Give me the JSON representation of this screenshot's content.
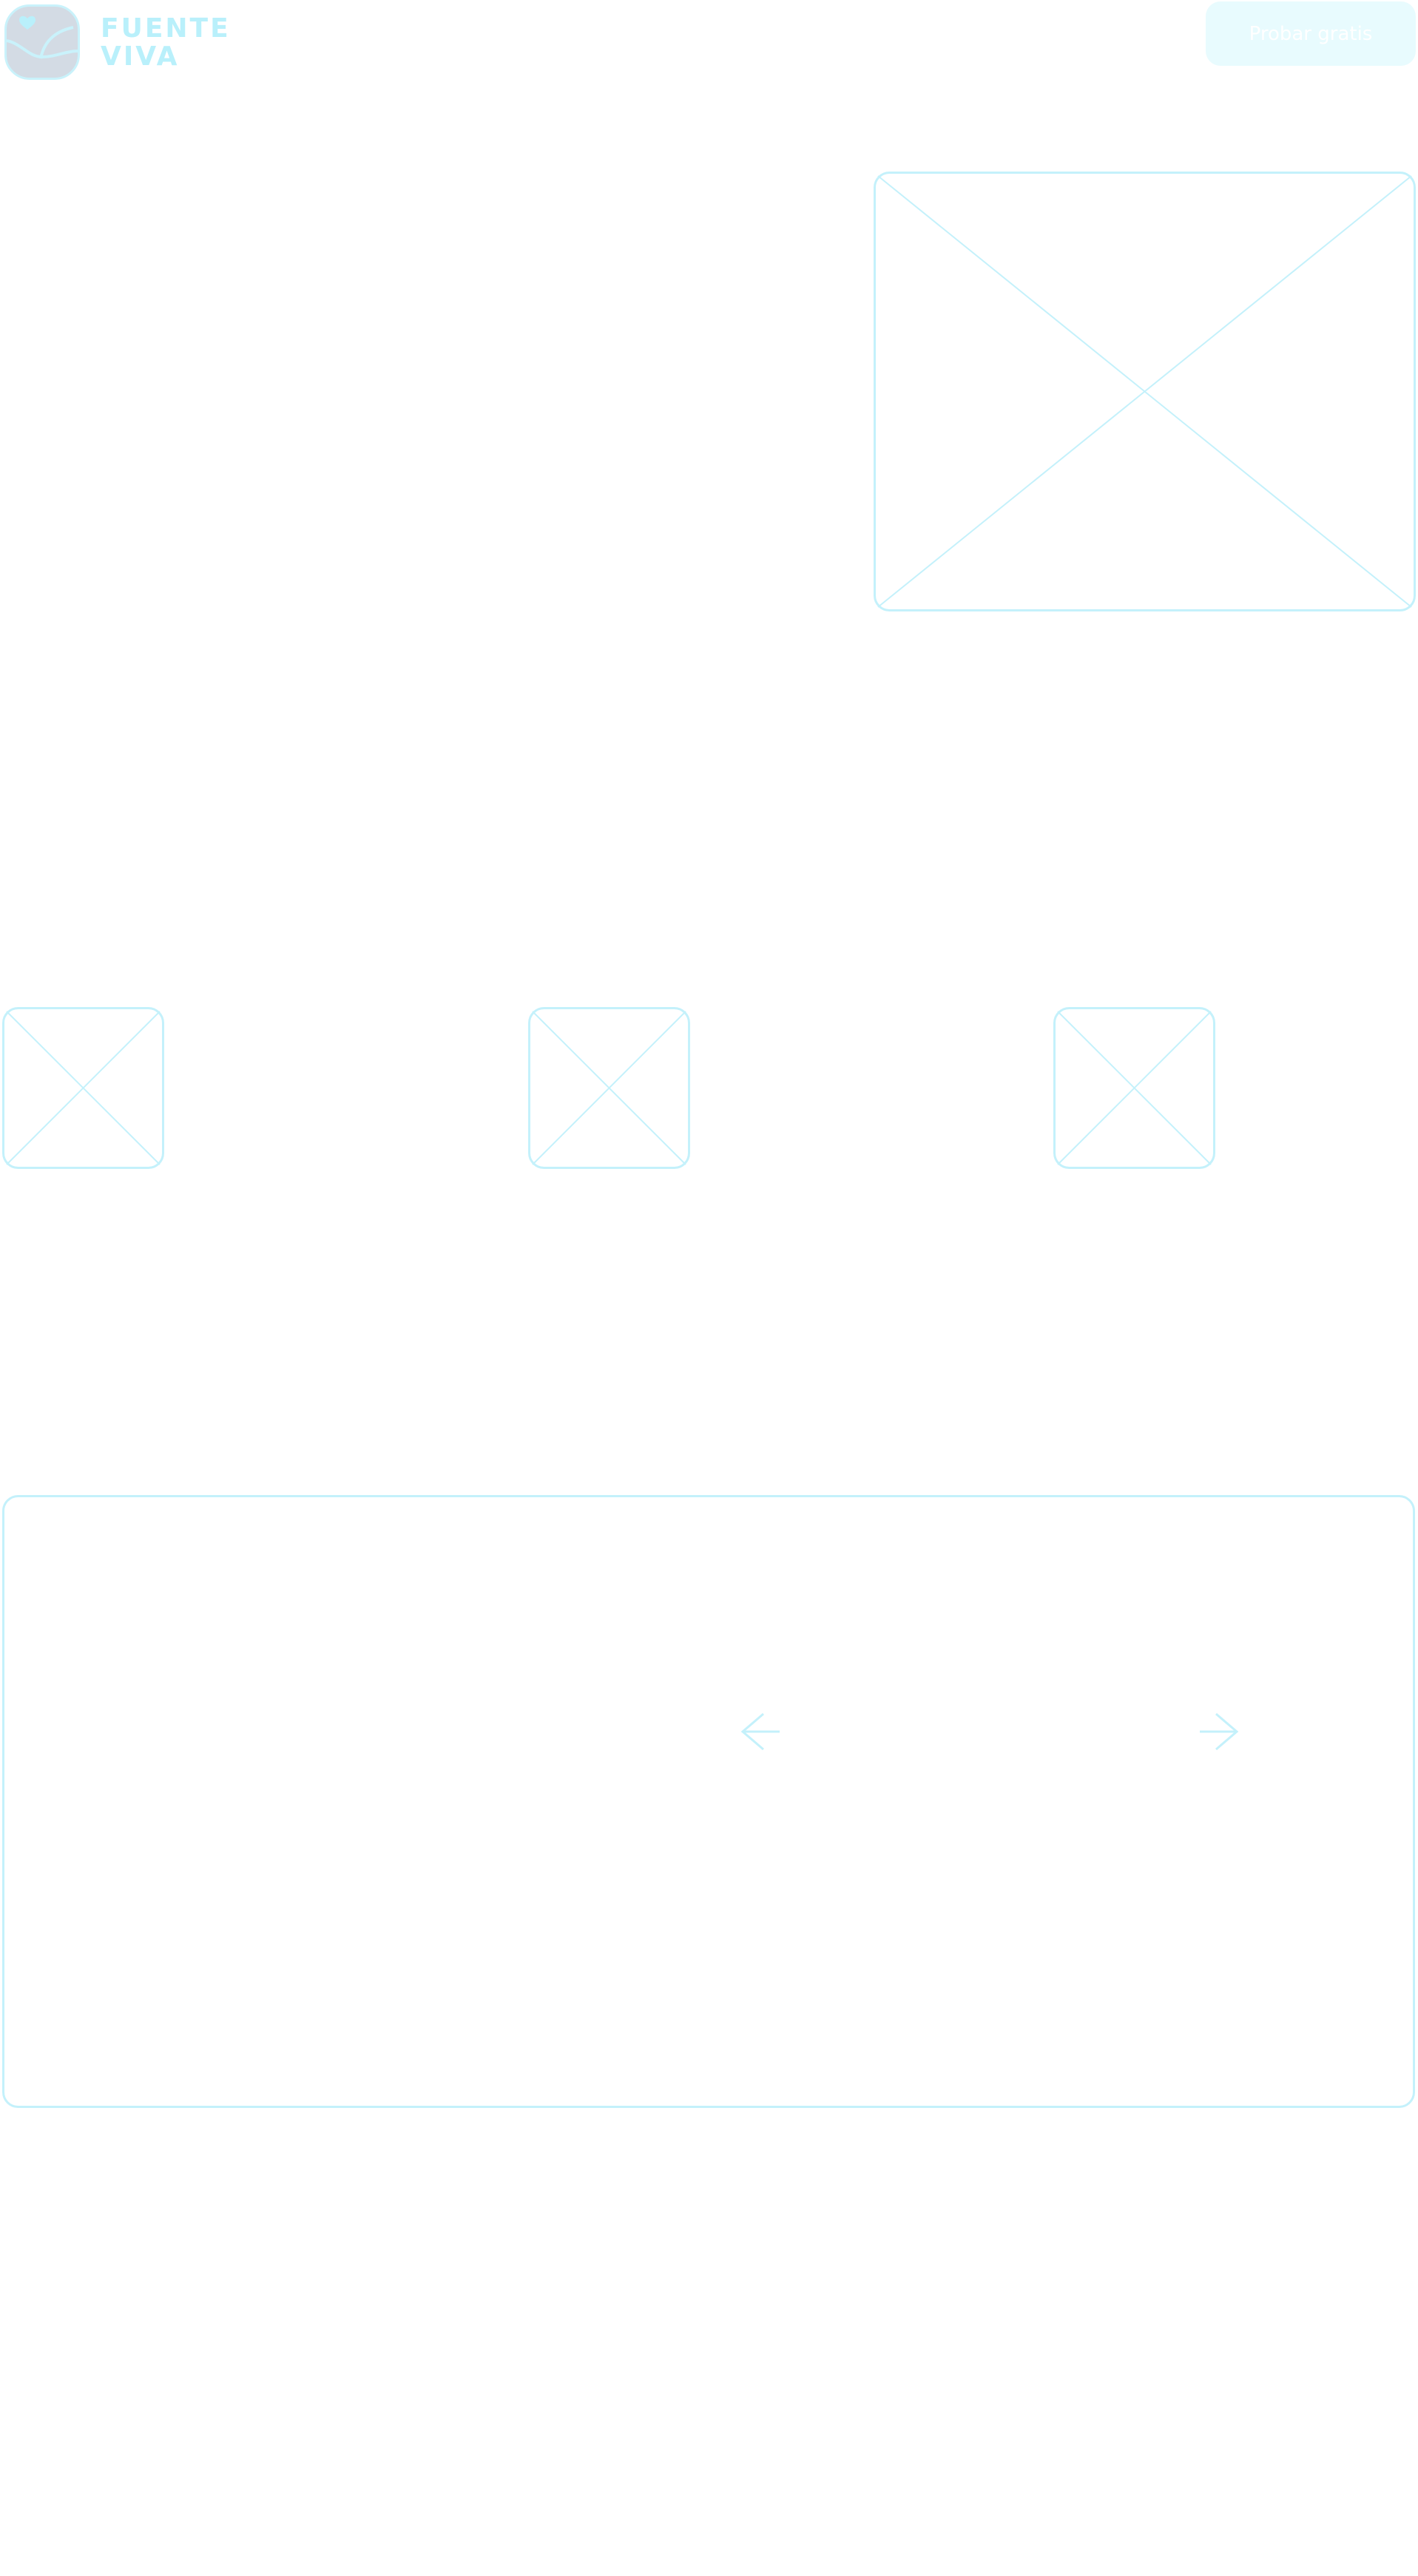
{
  "header": {
    "logo": {
      "icon": "heart-waves-logo-icon",
      "line1": "FUENTE",
      "line2": "VIVA"
    },
    "cta_label": "Probar gratis"
  },
  "hero": {
    "image_icon": "image-placeholder-icon"
  },
  "features": {
    "items": [
      {
        "icon": "image-placeholder-icon"
      },
      {
        "icon": "image-placeholder-icon"
      },
      {
        "icon": "image-placeholder-icon"
      }
    ]
  },
  "carousel": {
    "prev_icon": "arrow-left-icon",
    "next_icon": "arrow-right-icon"
  },
  "colors": {
    "wire": "#c4f1fb",
    "logo_bg": "#d3dbe4",
    "logo_text": "#b9f0fb",
    "button_bg": "#e8fbfe",
    "button_text": "#ffffff"
  }
}
